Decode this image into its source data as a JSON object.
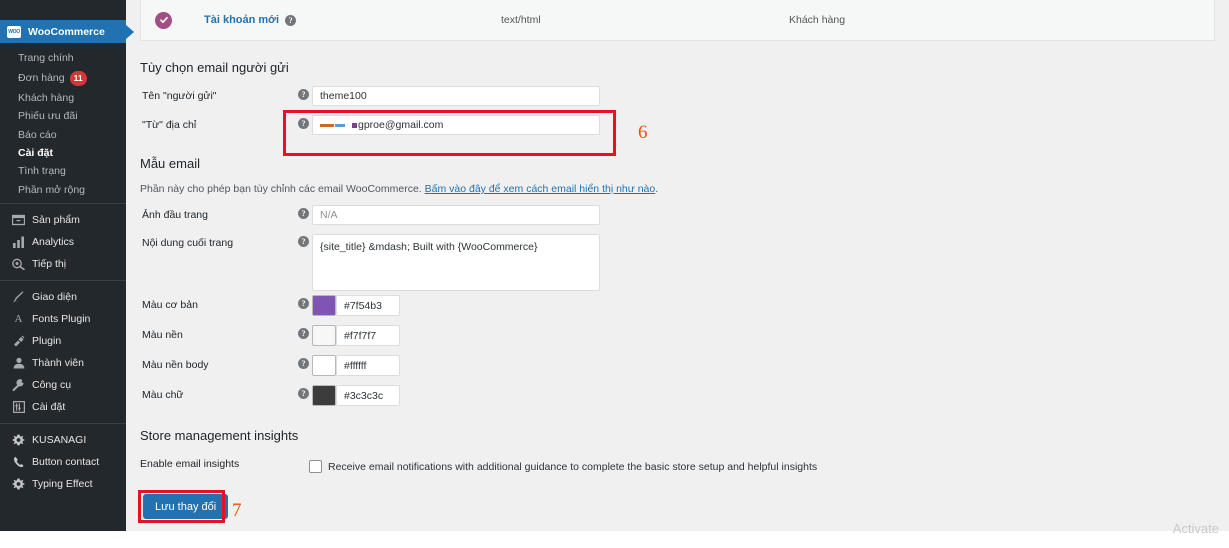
{
  "sidebar": {
    "brand": {
      "label": "WooCommerce",
      "logo_text": "WOO",
      "color": "#2271b1"
    },
    "submenu": [
      {
        "label": "Trang chính",
        "badge": null,
        "active": false
      },
      {
        "label": "Đơn hàng",
        "badge": "11",
        "active": false
      },
      {
        "label": "Khách hàng",
        "badge": null,
        "active": false
      },
      {
        "label": "Phiếu ưu đãi",
        "badge": null,
        "active": false
      },
      {
        "label": "Báo cáo",
        "badge": null,
        "active": false
      },
      {
        "label": "Cài đặt",
        "badge": null,
        "active": true
      },
      {
        "label": "Tình trạng",
        "badge": null,
        "active": false
      },
      {
        "label": "Phần mở rộng",
        "badge": null,
        "active": false
      }
    ],
    "group2": [
      {
        "label": "Sản phẩm",
        "icon": "product-box-icon"
      },
      {
        "label": "Analytics",
        "icon": "bar-chart-icon"
      },
      {
        "label": "Tiếp thị",
        "icon": "megaphone-icon"
      }
    ],
    "group3": [
      {
        "label": "Giao diện",
        "icon": "paintbrush-icon"
      },
      {
        "label": "Fonts Plugin",
        "icon": "letter-a-icon"
      },
      {
        "label": "Plugin",
        "icon": "plug-icon"
      },
      {
        "label": "Thành viên",
        "icon": "user-icon"
      },
      {
        "label": "Công cụ",
        "icon": "wrench-icon"
      },
      {
        "label": "Cài đặt",
        "icon": "sliders-icon"
      }
    ],
    "group4": [
      {
        "label": "KUSANAGI",
        "icon": "gear-icon"
      },
      {
        "label": "Button contact",
        "icon": "phone-icon"
      },
      {
        "label": "Typing Effect",
        "icon": "gear-icon"
      }
    ]
  },
  "top_row": {
    "status_icon": "check-circle-icon",
    "title": "Tài khoản mới",
    "help_icon": "help-icon",
    "content_type": "text/html",
    "recipient": "Khách hàng"
  },
  "sender": {
    "heading": "Tùy chọn email người gửi",
    "from_name": {
      "label": "Tên \"người gửi\"",
      "value": "theme100"
    },
    "from_address": {
      "label": "\"Từ\" địa chỉ",
      "value": "gproe@gmail.com"
    }
  },
  "template": {
    "heading": "Mẫu email",
    "desc_prefix": "Phần này cho phép bạn tùy chỉnh các email WooCommerce. ",
    "desc_link": "Bấm vào đây để xem cách email hiển thị như nào",
    "desc_suffix": ".",
    "header_image": {
      "label": "Ảnh đầu trang",
      "placeholder": "N/A",
      "value": ""
    },
    "footer_text": {
      "label": "Nội dung cuối trang",
      "value": "{site_title} &mdash; Built with {WooCommerce}"
    },
    "colors": [
      {
        "label": "Màu cơ bản",
        "value": "#7f54b3"
      },
      {
        "label": "Màu nền",
        "value": "#f7f7f7"
      },
      {
        "label": "Màu nền body",
        "value": "#ffffff"
      },
      {
        "label": "Màu chữ",
        "value": "#3c3c3c"
      }
    ]
  },
  "insights": {
    "heading": "Store management insights",
    "label": "Enable email insights",
    "checkbox_label": "Receive email notifications with additional guidance to complete the basic store setup and helpful insights",
    "checked": false
  },
  "footer": {
    "save_label": "Lưu thay đổi",
    "watermark": "Activate"
  },
  "annotations": {
    "marker_6": "6",
    "marker_7": "7",
    "box_color": "#e81123",
    "number_color": "#e8530e"
  }
}
